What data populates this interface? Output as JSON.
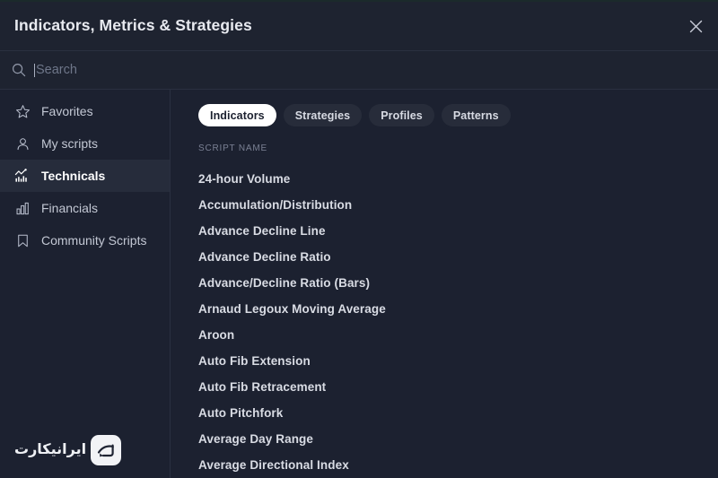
{
  "window": {
    "title": "Indicators, Metrics & Strategies",
    "close_icon": "close-icon"
  },
  "search": {
    "icon": "search-icon",
    "placeholder": "Search",
    "value": ""
  },
  "sidebar": {
    "items": [
      {
        "label": "Favorites",
        "icon": "star-icon",
        "active": false
      },
      {
        "label": "My scripts",
        "icon": "person-icon",
        "active": false
      },
      {
        "label": "Technicals",
        "icon": "line-chart-icon",
        "active": true
      },
      {
        "label": "Financials",
        "icon": "bar-chart-icon",
        "active": false
      },
      {
        "label": "Community Scripts",
        "icon": "bookmark-icon",
        "active": false
      }
    ]
  },
  "main": {
    "tabs": [
      {
        "label": "Indicators",
        "active": true
      },
      {
        "label": "Strategies",
        "active": false
      },
      {
        "label": "Profiles",
        "active": false
      },
      {
        "label": "Patterns",
        "active": false
      }
    ],
    "column_header": "SCRIPT NAME",
    "scripts": [
      {
        "name": "24-hour Volume"
      },
      {
        "name": "Accumulation/Distribution"
      },
      {
        "name": "Advance Decline Line"
      },
      {
        "name": "Advance Decline Ratio"
      },
      {
        "name": "Advance/Decline Ratio (Bars)"
      },
      {
        "name": "Arnaud Legoux Moving Average"
      },
      {
        "name": "Aroon"
      },
      {
        "name": "Auto Fib Extension"
      },
      {
        "name": "Auto Fib Retracement"
      },
      {
        "name": "Auto Pitchfork"
      },
      {
        "name": "Average Day Range"
      },
      {
        "name": "Average Directional Index"
      }
    ]
  },
  "watermark": {
    "text": "ایرانیکارت",
    "mark": "iranicard-logo-icon"
  },
  "colors": {
    "background": "#1c2130",
    "panel": "#1e2330",
    "divider": "#2a3040",
    "active_nav": "#262c3b",
    "accent_pill": "#ffffff",
    "text_primary": "#d9dce4",
    "text_muted": "#7a8093"
  }
}
